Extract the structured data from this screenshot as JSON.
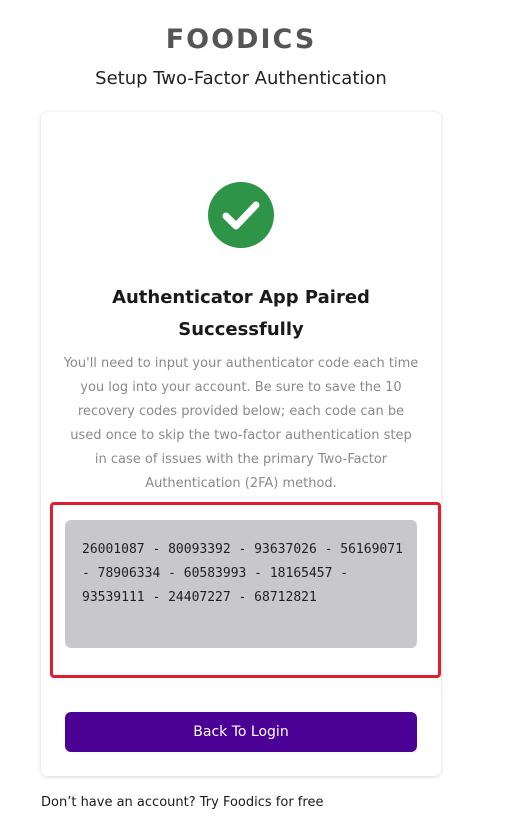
{
  "brand": {
    "logo_text": "FOODICS"
  },
  "page": {
    "title": "Setup Two-Factor Authentication"
  },
  "card": {
    "icon": "check-circle-icon",
    "heading": "Authenticator App Paired Successfully",
    "description": "You'll need to input your authenticator code each time you log into your account. Be sure to save the 10 recovery codes provided below; each code can be used once to skip the two-factor authentication step in case of issues with the primary Two-Factor Authentication (2FA) method.",
    "recovery_codes": "26001087 - 80093392 - 93637026 - 56169071 - 78906334 - 60583993 - 18165457 - 93539111 - 24407227 - 68712821",
    "button_label": "Back To Login"
  },
  "footer": {
    "prompt": "Don’t have an account?",
    "link_text": "Try Foodics for free"
  },
  "colors": {
    "success": "#2e9447",
    "primary": "#4b0096",
    "highlight": "#e21d2f",
    "code_bg": "#c8c8cc"
  }
}
